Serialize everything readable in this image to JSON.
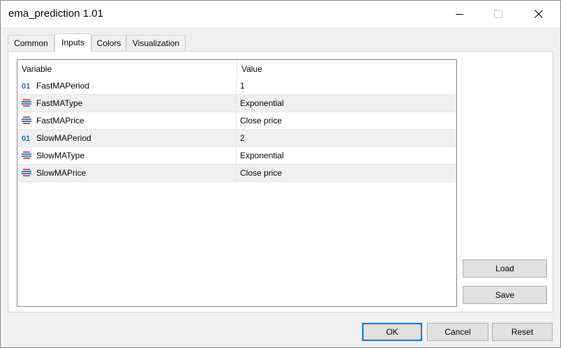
{
  "window": {
    "title": "ema_prediction 1.01"
  },
  "tabs": [
    {
      "label": "Common"
    },
    {
      "label": "Inputs"
    },
    {
      "label": "Colors"
    },
    {
      "label": "Visualization"
    }
  ],
  "active_tab": "Inputs",
  "grid": {
    "columns": [
      "Variable",
      "Value"
    ],
    "rows": [
      {
        "icon": "int-icon",
        "variable": "FastMAPeriod",
        "value": "1"
      },
      {
        "icon": "enum-icon",
        "variable": "FastMAType",
        "value": "Exponential"
      },
      {
        "icon": "enum-icon",
        "variable": "FastMAPrice",
        "value": "Close price"
      },
      {
        "icon": "int-icon",
        "variable": "SlowMAPeriod",
        "value": "2"
      },
      {
        "icon": "enum-icon",
        "variable": "SlowMAType",
        "value": "Exponential"
      },
      {
        "icon": "enum-icon",
        "variable": "SlowMAPrice",
        "value": "Close price"
      }
    ],
    "int_icon_text": "01"
  },
  "side_buttons": {
    "load": "Load",
    "save": "Save"
  },
  "footer_buttons": {
    "ok": "OK",
    "cancel": "Cancel",
    "reset": "Reset"
  },
  "colors": {
    "accent": "#0078d7",
    "alt_row": "#f0f0f0",
    "int_icon": "#1f6fb5"
  }
}
